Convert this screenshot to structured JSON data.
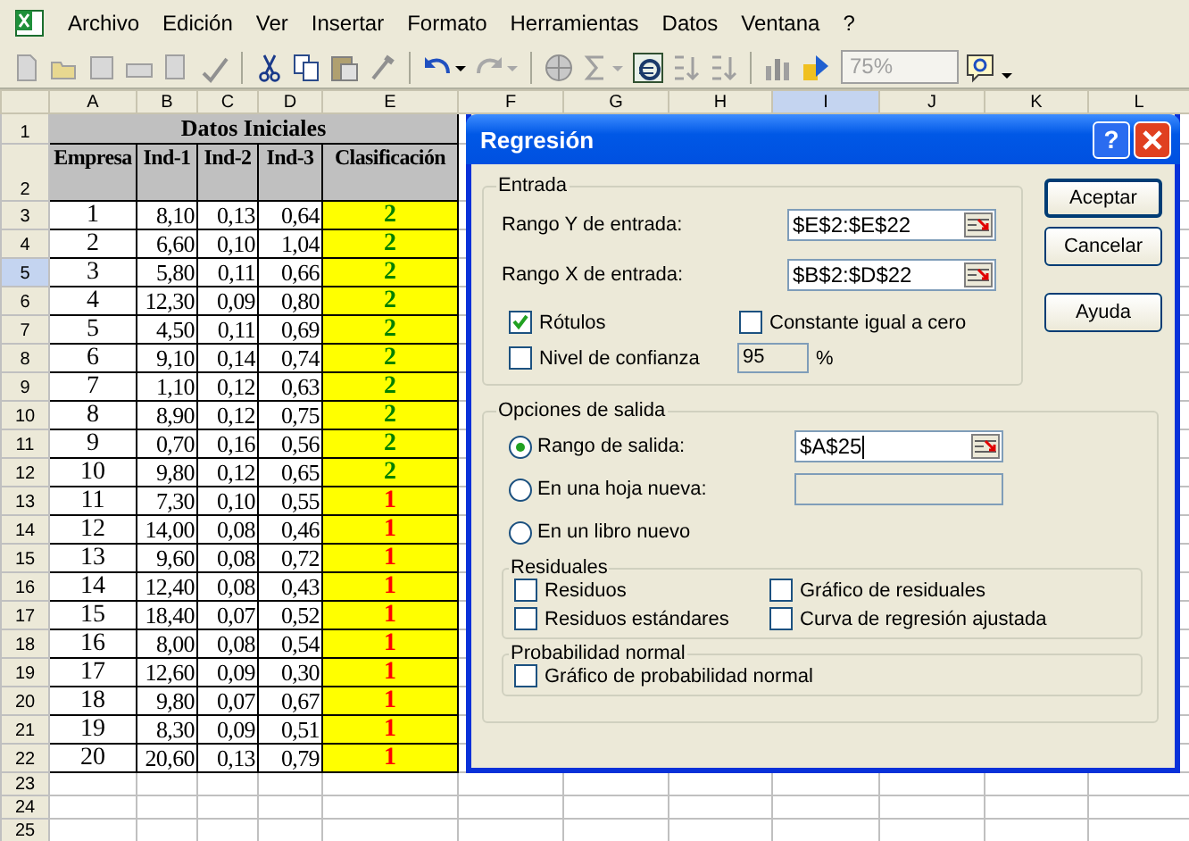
{
  "menu": [
    "Archivo",
    "Edición",
    "Ver",
    "Insertar",
    "Formato",
    "Herramientas",
    "Datos",
    "Ventana",
    "?"
  ],
  "toolbar": {
    "zoom": "75%"
  },
  "sheet": {
    "columns": [
      {
        "label": "A",
        "selected": false
      },
      {
        "label": "B",
        "selected": false
      },
      {
        "label": "C",
        "selected": false
      },
      {
        "label": "D",
        "selected": false
      },
      {
        "label": "E",
        "selected": false
      },
      {
        "label": "F",
        "selected": false
      },
      {
        "label": "G",
        "selected": false
      },
      {
        "label": "H",
        "selected": false
      },
      {
        "label": "I",
        "selected": true
      },
      {
        "label": "J",
        "selected": false
      },
      {
        "label": "K",
        "selected": false
      },
      {
        "label": "L",
        "selected": false
      }
    ],
    "row_numbers": [
      {
        "label": "1",
        "selected": false
      },
      {
        "label": "2",
        "selected": false
      },
      {
        "label": "3",
        "selected": false
      },
      {
        "label": "4",
        "selected": false
      },
      {
        "label": "5",
        "selected": true
      },
      {
        "label": "6",
        "selected": false
      },
      {
        "label": "7",
        "selected": false
      },
      {
        "label": "8",
        "selected": false
      },
      {
        "label": "9",
        "selected": false
      },
      {
        "label": "10",
        "selected": false
      },
      {
        "label": "11",
        "selected": false
      },
      {
        "label": "12",
        "selected": false
      },
      {
        "label": "13",
        "selected": false
      },
      {
        "label": "14",
        "selected": false
      },
      {
        "label": "15",
        "selected": false
      },
      {
        "label": "16",
        "selected": false
      },
      {
        "label": "17",
        "selected": false
      },
      {
        "label": "18",
        "selected": false
      },
      {
        "label": "19",
        "selected": false
      },
      {
        "label": "20",
        "selected": false
      },
      {
        "label": "21",
        "selected": false
      },
      {
        "label": "22",
        "selected": false
      },
      {
        "label": "23",
        "selected": false
      },
      {
        "label": "24",
        "selected": false
      },
      {
        "label": "25",
        "selected": false
      }
    ],
    "title": "Datos Iniciales",
    "headers": [
      "Empresa",
      "Ind-1",
      "Ind-2",
      "Ind-3",
      "Clasificación"
    ],
    "rows": [
      {
        "values": [
          "1",
          "8,10",
          "0,13",
          "0,64"
        ],
        "clasificacion": "2",
        "color": "#008000"
      },
      {
        "values": [
          "2",
          "6,60",
          "0,10",
          "1,04"
        ],
        "clasificacion": "2",
        "color": "#008000"
      },
      {
        "values": [
          "3",
          "5,80",
          "0,11",
          "0,66"
        ],
        "clasificacion": "2",
        "color": "#008000"
      },
      {
        "values": [
          "4",
          "12,30",
          "0,09",
          "0,80"
        ],
        "clasificacion": "2",
        "color": "#008000"
      },
      {
        "values": [
          "5",
          "4,50",
          "0,11",
          "0,69"
        ],
        "clasificacion": "2",
        "color": "#008000"
      },
      {
        "values": [
          "6",
          "9,10",
          "0,14",
          "0,74"
        ],
        "clasificacion": "2",
        "color": "#008000"
      },
      {
        "values": [
          "7",
          "1,10",
          "0,12",
          "0,63"
        ],
        "clasificacion": "2",
        "color": "#008000"
      },
      {
        "values": [
          "8",
          "8,90",
          "0,12",
          "0,75"
        ],
        "clasificacion": "2",
        "color": "#008000"
      },
      {
        "values": [
          "9",
          "0,70",
          "0,16",
          "0,56"
        ],
        "clasificacion": "2",
        "color": "#008000"
      },
      {
        "values": [
          "10",
          "9,80",
          "0,12",
          "0,65"
        ],
        "clasificacion": "2",
        "color": "#008000"
      },
      {
        "values": [
          "11",
          "7,30",
          "0,10",
          "0,55"
        ],
        "clasificacion": "1",
        "color": "#ff0000"
      },
      {
        "values": [
          "12",
          "14,00",
          "0,08",
          "0,46"
        ],
        "clasificacion": "1",
        "color": "#ff0000"
      },
      {
        "values": [
          "13",
          "9,60",
          "0,08",
          "0,72"
        ],
        "clasificacion": "1",
        "color": "#ff0000"
      },
      {
        "values": [
          "14",
          "12,40",
          "0,08",
          "0,43"
        ],
        "clasificacion": "1",
        "color": "#ff0000"
      },
      {
        "values": [
          "15",
          "18,40",
          "0,07",
          "0,52"
        ],
        "clasificacion": "1",
        "color": "#ff0000"
      },
      {
        "values": [
          "16",
          "8,00",
          "0,08",
          "0,54"
        ],
        "clasificacion": "1",
        "color": "#ff0000"
      },
      {
        "values": [
          "17",
          "12,60",
          "0,09",
          "0,30"
        ],
        "clasificacion": "1",
        "color": "#ff0000"
      },
      {
        "values": [
          "18",
          "9,80",
          "0,07",
          "0,67"
        ],
        "clasificacion": "1",
        "color": "#ff0000"
      },
      {
        "values": [
          "19",
          "8,30",
          "0,09",
          "0,51"
        ],
        "clasificacion": "1",
        "color": "#ff0000"
      },
      {
        "values": [
          "20",
          "20,60",
          "0,13",
          "0,79"
        ],
        "clasificacion": "1",
        "color": "#ff0000"
      }
    ]
  },
  "dialog": {
    "title": "Regresión",
    "help_button": "?",
    "buttons": [
      {
        "label": "Aceptar",
        "default": true
      },
      {
        "label": "Cancelar",
        "default": false
      },
      {
        "label": "Ayuda",
        "default": false
      }
    ],
    "entrada": {
      "title": "Entrada",
      "fields": [
        {
          "label": "Rango Y de entrada:",
          "value": "$E$2:$E$22"
        },
        {
          "label": "Rango X de entrada:",
          "value": "$B$2:$D$22"
        }
      ],
      "checks": [
        {
          "label": "Rótulos",
          "checked": true
        },
        {
          "label": "Constante igual a cero",
          "checked": false
        }
      ],
      "confianza": {
        "label": "Nivel de confianza",
        "checked": false,
        "value": "95",
        "unit": "%",
        "disabled": true
      }
    },
    "salida": {
      "title": "Opciones de salida",
      "options": [
        {
          "label": "Rango de salida:",
          "selected": true,
          "kind": "field",
          "value": "$A$25",
          "disabled": false
        },
        {
          "label": "En una hoja nueva:",
          "selected": false,
          "kind": "field",
          "disabled": true
        },
        {
          "label": "En un libro nuevo",
          "selected": false,
          "kind": "plain"
        }
      ],
      "residuales": {
        "title": "Residuales",
        "checks": [
          {
            "label": "Residuos",
            "checked": false
          },
          {
            "label": "Gráfico de residuales",
            "checked": false
          },
          {
            "label": "Residuos estándares",
            "checked": false
          },
          {
            "label": "Curva de regresión ajustada",
            "checked": false
          }
        ]
      },
      "probabilidad": {
        "title": "Probabilidad normal",
        "checks": [
          {
            "label": "Gráfico de probabilidad normal",
            "checked": false
          }
        ]
      }
    }
  }
}
